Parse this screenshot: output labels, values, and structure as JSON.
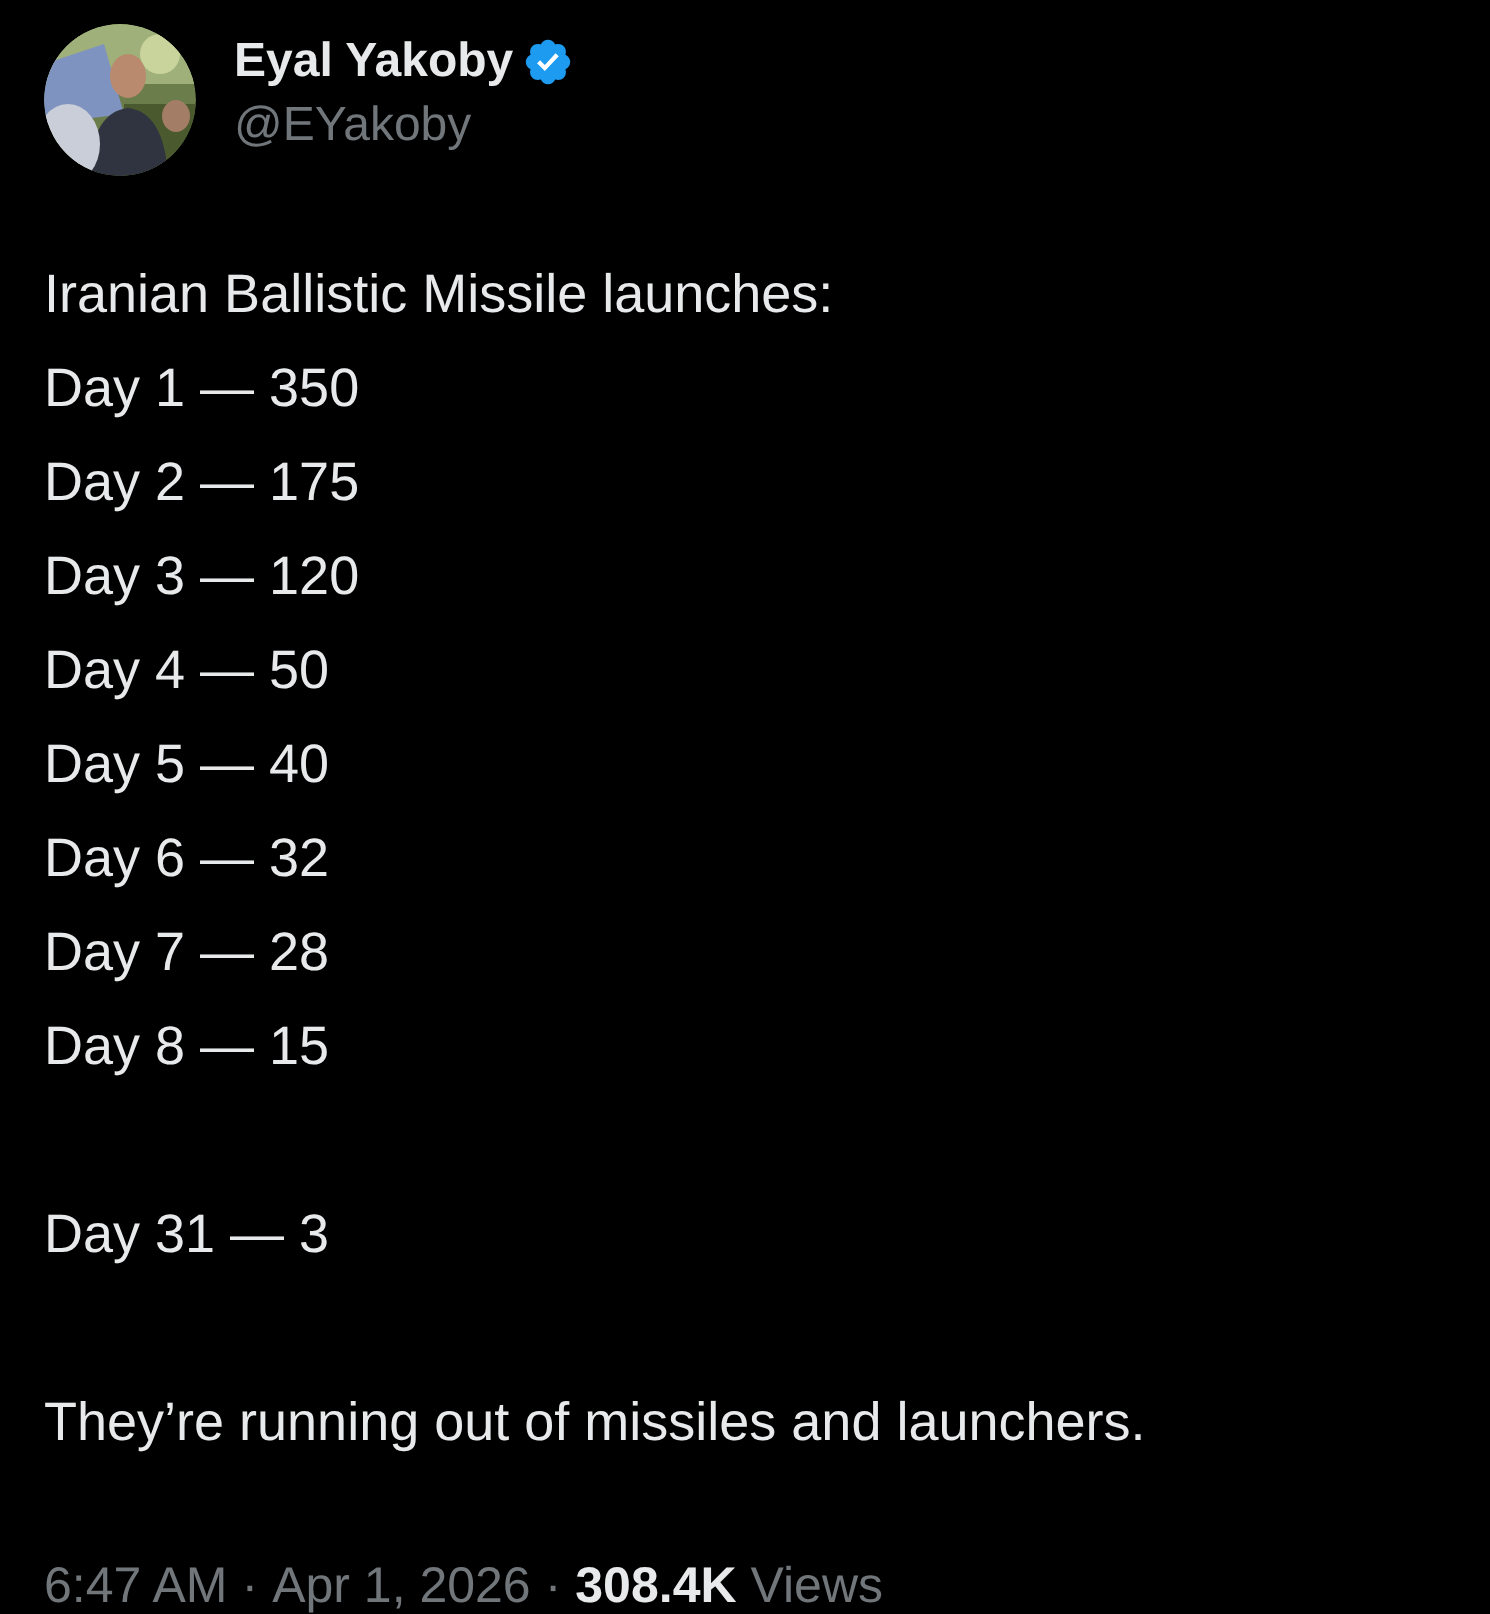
{
  "author": {
    "name": "Eyal Yakoby",
    "verified": true,
    "handle": "@EYakoby"
  },
  "paragraphs": [
    [
      "Iranian Ballistic Missile launches:",
      "Day 1 — 350",
      "Day 2 — 175",
      "Day 3 — 120",
      "Day 4 — 50",
      "Day 5 — 40",
      "Day 6 — 32",
      "Day 7 — 28",
      "Day 8 — 15"
    ],
    [
      "Day 31 — 3"
    ],
    [
      "They’re running out of missiles and launchers."
    ]
  ],
  "meta": [
    {
      "kind": "time",
      "text": "6:47 AM"
    },
    {
      "kind": "separator",
      "text": "·"
    },
    {
      "kind": "date",
      "text": "Apr 1, 2026"
    },
    {
      "kind": "separator",
      "text": "·"
    },
    {
      "kind": "count",
      "text": "308.4K"
    },
    {
      "kind": "label",
      "text": "Views"
    }
  ]
}
